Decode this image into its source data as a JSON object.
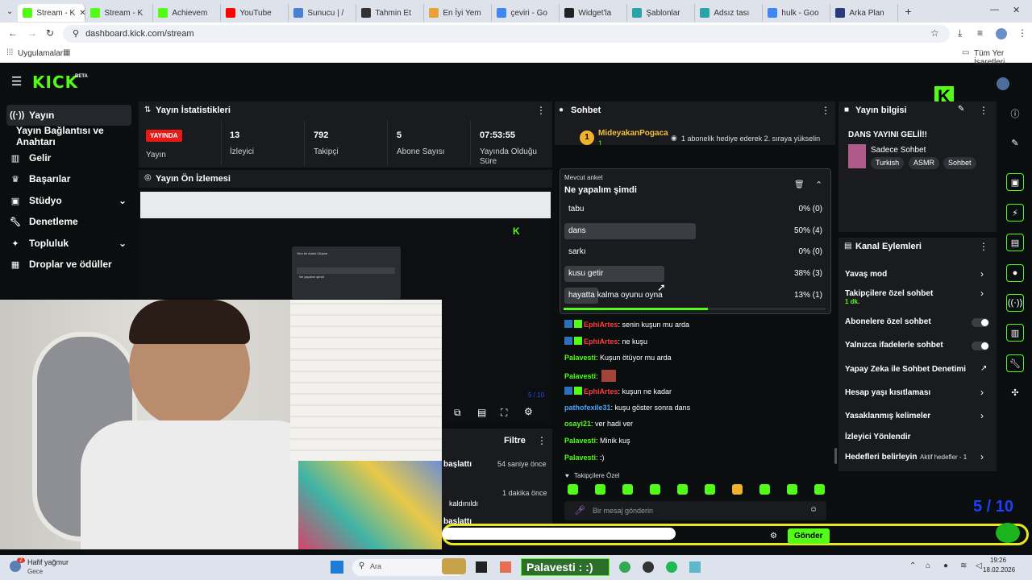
{
  "browser": {
    "tabs": [
      "Stream - K",
      "Stream - K",
      "Achievem",
      "YouTube",
      "Sunucu | /",
      "Tahmin Et",
      "En İyi Yem",
      "çeviri - Go",
      "Widget'la",
      "Şablonlar",
      "Adsız tası",
      "hulk - Goo",
      "Arka Plan"
    ],
    "url": "dashboard.kick.com/stream",
    "bookmarks_apps": "Uygulamalar",
    "bookmarks_all": "Tüm Yer İşaretleri"
  },
  "header": {
    "logo": "KICK",
    "beta": "BETA"
  },
  "sidebar": {
    "items": [
      {
        "label": "Yayın",
        "icon": "broadcast-icon"
      },
      {
        "label": "Yayın Bağlantısı ve Anahtarı",
        "icon": "key-icon"
      },
      {
        "label": "Gelir",
        "icon": "revenue-icon"
      },
      {
        "label": "Başarılar",
        "icon": "trophy-icon"
      },
      {
        "label": "Stüdyo",
        "icon": "studio-icon"
      },
      {
        "label": "Denetleme",
        "icon": "wrench-icon"
      },
      {
        "label": "Topluluk",
        "icon": "community-icon"
      },
      {
        "label": "Droplar ve ödüller",
        "icon": "gift-icon"
      }
    ]
  },
  "stats": {
    "title": "Yayın İstatistikleri",
    "live_badge": "YAYINDA",
    "live_label": "Yayın",
    "viewers": "13",
    "viewers_label": "İzleyici",
    "followers": "792",
    "followers_label": "Takipçi",
    "subs": "5",
    "subs_label": "Abone Sayısı",
    "uptime": "07:53:55",
    "uptime_label": "Yayında Olduğu Süre"
  },
  "preview": {
    "title": "Yayın Ön İzlemesi",
    "inner_dialog_title": "Yeni bir Anket Oluştur",
    "inner_dialog_value": "Ne yapalım şimdi"
  },
  "activity": {
    "filter_label": "Filtre",
    "rows": [
      {
        "text": "başlattı",
        "time": "54 saniye önce"
      },
      {
        "text": "",
        "time": "1 dakika önce"
      },
      {
        "text": "kaldınıldı",
        "time": ""
      },
      {
        "text": "başlattı",
        "time": ""
      }
    ]
  },
  "chat": {
    "title": "Sohbet",
    "pinned_user": "MideyakanPogaca",
    "pinned_count": "1",
    "pinned_text": "1 abonelik hediye ederek 2. sıraya yükselin",
    "poll": {
      "label": "Mevcut anket",
      "question": "Ne yapalım şimdi",
      "options": [
        {
          "label": "tabu",
          "value": "0% (0)",
          "pct": 0
        },
        {
          "label": "dans",
          "value": "50% (4)",
          "pct": 50
        },
        {
          "label": "sarkı",
          "value": "0% (0)",
          "pct": 0
        },
        {
          "label": "kusu getir",
          "value": "38% (3)",
          "pct": 38
        },
        {
          "label": "hayatta kalma oyunu oyna",
          "value": "13% (1)",
          "pct": 13
        }
      ],
      "time_remaining_fraction": 0.55
    },
    "messages": [
      {
        "user": "EphiArtes",
        "text": ": senin kuşun mu arda",
        "color": "#ff3b3b",
        "badges": true
      },
      {
        "user": "EphiArtes",
        "text": ": ne kuşu",
        "color": "#ff3b3b",
        "badges": true
      },
      {
        "user": "Palavesti",
        "text": ": Kuşun ötüyor mu arda",
        "color": "#53fc18",
        "badges": false
      },
      {
        "user": "Palavesti",
        "text": ":",
        "color": "#53fc18",
        "badges": false,
        "emote": true
      },
      {
        "user": "EphiArtes",
        "text": ": kuşun ne kadar",
        "color": "#ff3b3b",
        "badges": true
      },
      {
        "user": "pathofexile31",
        "text": ": kuşu göster sonra dans",
        "color": "#4da3ff",
        "badges": false
      },
      {
        "user": "osayi21",
        "text": ": ver hadi ver",
        "color": "#53fc18",
        "badges": false
      },
      {
        "user": "Palavesti",
        "text": ": Minik kuş",
        "color": "#53fc18",
        "badges": false
      },
      {
        "user": "Palavesti",
        "text": ": :)",
        "color": "#53fc18",
        "badges": false
      }
    ],
    "followers_only_label": "Takipçilere Özel",
    "input_placeholder": "Bir mesaj gönderin",
    "send_label": "Gönder"
  },
  "stream_info": {
    "title": "Yayın bilgisi",
    "stream_title": "DANS YAYINI GELİİ!!",
    "category": "Sadece Sohbet",
    "tags": [
      "Turkish",
      "ASMR",
      "Sohbet"
    ]
  },
  "channel_actions": {
    "title": "Kanal Eylemleri",
    "items": [
      {
        "label": "Yavaş mod",
        "type": "chevron"
      },
      {
        "label": "Takipçilere özel sohbet",
        "sub": "1 dk.",
        "type": "chevron"
      },
      {
        "label": "Abonelere özel sohbet",
        "type": "toggle"
      },
      {
        "label": "Yalnızca ifadelerle sohbet",
        "type": "toggle"
      },
      {
        "label": "Yapay Zeka ile Sohbet Denetimi",
        "type": "external"
      },
      {
        "label": "Hesap yaşı kısıtlaması",
        "type": "chevron"
      },
      {
        "label": "Yasaklanmış kelimeler",
        "type": "chevron"
      },
      {
        "label": "İzleyici Yönlendir",
        "type": "none"
      },
      {
        "label": "Hedefleri belirleyin",
        "sub": "Aktif hedefler - 1",
        "type": "chevron"
      }
    ]
  },
  "overlay": {
    "goal_text": "5 / 10",
    "chat_popup": "Palavesti : :)",
    "small_goal": "5 / 10"
  },
  "taskbar": {
    "weather_title": "Hafif yağmur",
    "weather_sub": "Gece",
    "weather_badge": "2",
    "search_placeholder": "Ara",
    "time": "19:26",
    "date": "18.02.2026"
  },
  "colors": {
    "kick_green": "#53fc18",
    "live_red": "#e91916",
    "panel": "#191b1f",
    "bg": "#0b0e0f"
  }
}
